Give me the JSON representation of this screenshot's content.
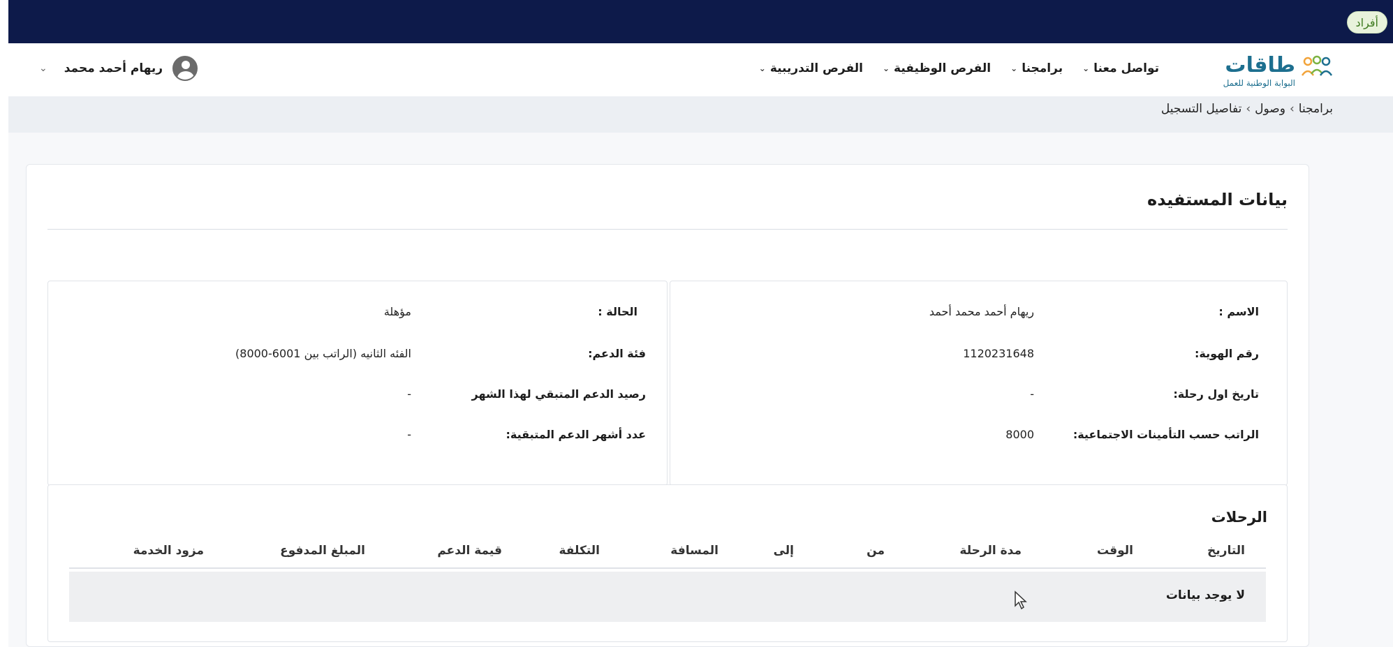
{
  "topbar": {
    "badge": "أفراد"
  },
  "brand": {
    "name": "طاقات",
    "tagline": "البوابة الوطنية للعمل",
    "logo_icon": "people-group-icon"
  },
  "nav": {
    "items": [
      {
        "label": "تواصل معنا"
      },
      {
        "label": "برامجنا"
      },
      {
        "label": "الفرص الوظيفية"
      },
      {
        "label": "الفرص التدريبية"
      }
    ]
  },
  "user": {
    "name": "ريهام أحمد محمد",
    "icon": "user-avatar-icon"
  },
  "breadcrumb": {
    "items": [
      "برامجنا",
      "وصول",
      "تفاصيل التسجيل"
    ],
    "separator": "›"
  },
  "beneficiary": {
    "title": "بيانات المستفيده",
    "right": {
      "name_label": "الاسم :",
      "name_value": "ريهام أحمد محمد  أحمد",
      "id_label": "رقم الهوية:",
      "id_value": "1120231648",
      "first_trip_label": "تاريخ اول رحلة:",
      "first_trip_value": "-",
      "salary_label": "الراتب حسب التأمينات الاجتماعية:",
      "salary_value": "8000"
    },
    "left": {
      "status_label": "الحالة :",
      "status_value": "مؤهلة",
      "category_label": "فئة الدعم:",
      "category_value": "الفئه الثانيه (الراتب بين 6001-8000)",
      "balance_label": "رصيد الدعم المتبقي لهذا الشهر",
      "balance_value": "-",
      "months_label": "عدد أشهر الدعم المتبقية:",
      "months_value": "-"
    }
  },
  "trips": {
    "title": "الرحلات",
    "columns": [
      "التاريخ",
      "الوقت",
      "مدة الرحلة",
      "من",
      "إلى",
      "المسافة",
      "التكلفة",
      "قيمة الدعم",
      "المبلغ المدفوع",
      "مزود الخدمة"
    ],
    "empty": "لا يوجد بيانات"
  },
  "colors": {
    "topbar": "#0d1a4a",
    "brand": "#1d6f8f",
    "badge_bg": "#e8f3dc",
    "badge_text": "#3d7a1f"
  }
}
